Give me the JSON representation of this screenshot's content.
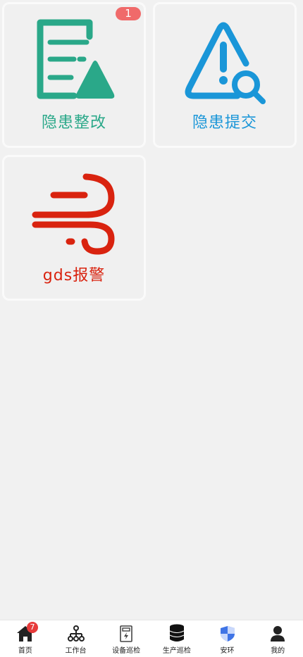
{
  "cards": [
    {
      "label": "隐患整改",
      "badge": "1",
      "icon": "rectification-document-icon",
      "color": "#2aa889"
    },
    {
      "label": "隐患提交",
      "icon": "warning-search-icon",
      "color": "#1a96d8"
    },
    {
      "label": "gds报警",
      "icon": "wind-alarm-icon",
      "color": "#d9230f"
    }
  ],
  "tabbar": {
    "items": [
      {
        "label": "首页",
        "icon": "home-icon",
        "badge": "7"
      },
      {
        "label": "工作台",
        "icon": "org-chart-icon"
      },
      {
        "label": "设备巡检",
        "icon": "device-inspection-icon"
      },
      {
        "label": "生产巡检",
        "icon": "database-icon"
      },
      {
        "label": "安环",
        "icon": "shield-icon",
        "accent": "#3f74e6"
      },
      {
        "label": "我的",
        "icon": "user-icon"
      }
    ]
  }
}
